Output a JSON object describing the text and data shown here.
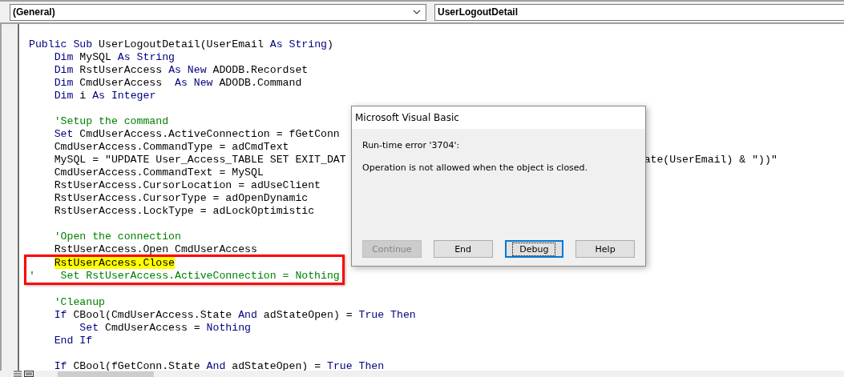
{
  "object_dropdown": {
    "value": "(General)"
  },
  "procedure_dropdown": {
    "value": "UserLogoutDetail"
  },
  "code_lines": [
    {
      "tokens": [
        {
          "kind": "keyword",
          "text": "Public Sub"
        },
        {
          "kind": "plain",
          "text": " UserLogoutDetail(UserEmail "
        },
        {
          "kind": "keyword",
          "text": "As String"
        },
        {
          "kind": "plain",
          "text": ")"
        }
      ]
    },
    {
      "tokens": [
        {
          "kind": "keyword",
          "text": "    Dim"
        },
        {
          "kind": "plain",
          "text": " MySQL "
        },
        {
          "kind": "keyword",
          "text": "As String"
        }
      ]
    },
    {
      "tokens": [
        {
          "kind": "keyword",
          "text": "    Dim"
        },
        {
          "kind": "plain",
          "text": " RstUserAccess "
        },
        {
          "kind": "keyword",
          "text": "As New"
        },
        {
          "kind": "plain",
          "text": " ADODB.Recordset"
        }
      ]
    },
    {
      "tokens": [
        {
          "kind": "keyword",
          "text": "    Dim"
        },
        {
          "kind": "plain",
          "text": " CmdUserAccess  "
        },
        {
          "kind": "keyword",
          "text": "As New"
        },
        {
          "kind": "plain",
          "text": " ADODB.Command"
        }
      ]
    },
    {
      "tokens": [
        {
          "kind": "keyword",
          "text": "    Dim"
        },
        {
          "kind": "plain",
          "text": " i "
        },
        {
          "kind": "keyword",
          "text": "As Integer"
        }
      ]
    },
    {
      "kind": "blank"
    },
    {
      "tokens": [
        {
          "kind": "comment",
          "text": "    'Setup the command"
        }
      ]
    },
    {
      "tokens": [
        {
          "kind": "keyword",
          "text": "    Set"
        },
        {
          "kind": "plain",
          "text": " CmdUserAccess.ActiveConnection = fGetConn"
        }
      ]
    },
    {
      "tokens": [
        {
          "kind": "plain",
          "text": "    CmdUserAccess.CommandType = adCmdText"
        }
      ]
    },
    {
      "tokens": [
        {
          "kind": "plain",
          "text": "    MySQL = \"UPDATE User_Access_TABLE SET EXIT_DAT"
        }
      ],
      "tail": "ate(UserEmail) & \"))\""
    },
    {
      "tokens": [
        {
          "kind": "plain",
          "text": "    CmdUserAccess.CommandText = MySQL"
        }
      ]
    },
    {
      "tokens": [
        {
          "kind": "plain",
          "text": "    RstUserAccess.CursorLocation = adUseClient"
        }
      ]
    },
    {
      "tokens": [
        {
          "kind": "plain",
          "text": "    RstUserAccess.CursorType = adOpenDynamic"
        }
      ]
    },
    {
      "tokens": [
        {
          "kind": "plain",
          "text": "    RstUserAccess.LockType = adLockOptimistic"
        }
      ]
    },
    {
      "kind": "blank"
    },
    {
      "tokens": [
        {
          "kind": "comment",
          "text": "    'Open the connection"
        }
      ]
    },
    {
      "tokens": [
        {
          "kind": "plain",
          "text": "    RstUserAccess.Open CmdUserAccess"
        }
      ]
    },
    {
      "kind": "box",
      "lines": [
        {
          "tokens": [
            {
              "kind": "indent"
            },
            {
              "kind": "plain",
              "text": "RstUserAccess.Close",
              "highlighted": true
            }
          ]
        },
        {
          "tokens": [
            {
              "kind": "comment",
              "text": "'    Set RstUserAccess.ActiveConnection = Nothing"
            }
          ]
        }
      ]
    },
    {
      "kind": "blank"
    },
    {
      "tokens": [
        {
          "kind": "comment",
          "text": "    'Cleanup"
        }
      ]
    },
    {
      "tokens": [
        {
          "kind": "keyword",
          "text": "    If"
        },
        {
          "kind": "plain",
          "text": " CBool(CmdUserAccess.State "
        },
        {
          "kind": "keyword",
          "text": "And"
        },
        {
          "kind": "plain",
          "text": " adStateOpen) = "
        },
        {
          "kind": "keyword",
          "text": "True Then"
        }
      ]
    },
    {
      "tokens": [
        {
          "kind": "keyword",
          "text": "        Set"
        },
        {
          "kind": "plain",
          "text": " CmdUserAccess = "
        },
        {
          "kind": "keyword",
          "text": "Nothing"
        }
      ]
    },
    {
      "tokens": [
        {
          "kind": "keyword",
          "text": "    End If"
        }
      ]
    },
    {
      "kind": "blank"
    },
    {
      "tokens": [
        {
          "kind": "keyword",
          "text": "    If"
        },
        {
          "kind": "plain",
          "text": " CBool(fGetConn.State "
        },
        {
          "kind": "keyword",
          "text": "And"
        },
        {
          "kind": "plain",
          "text": " adStateOpen) = "
        },
        {
          "kind": "keyword",
          "text": "True Then"
        }
      ]
    }
  ],
  "dialog": {
    "title": "Microsoft Visual Basic",
    "error": "Run-time error '3704':",
    "message": "Operation is not allowed when the object is closed.",
    "buttons": [
      {
        "label": "Continue",
        "disabled": true,
        "focused": false
      },
      {
        "label": "End",
        "disabled": false,
        "focused": false
      },
      {
        "label": "Debug",
        "disabled": false,
        "focused": true
      },
      {
        "label": "Help",
        "disabled": false,
        "focused": false
      }
    ]
  }
}
